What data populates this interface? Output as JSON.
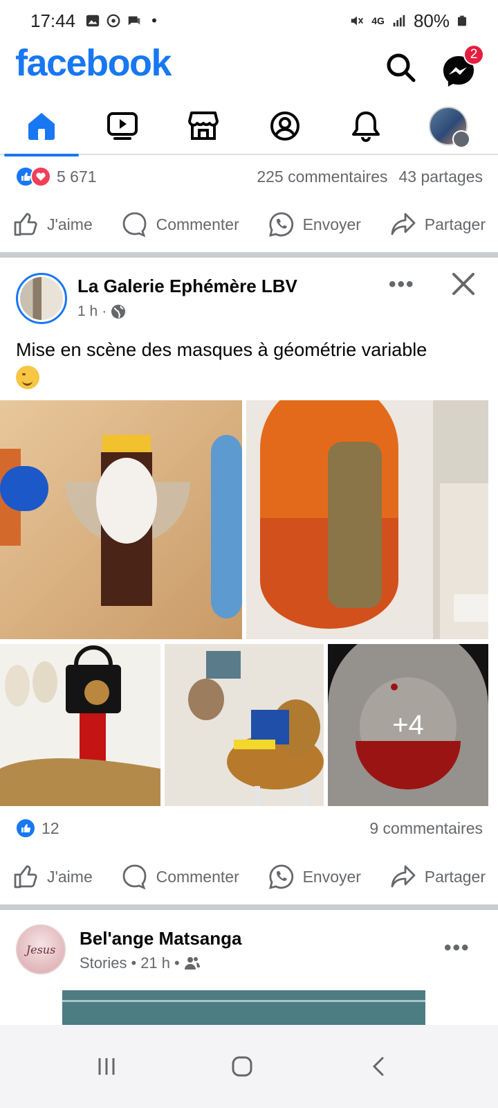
{
  "status_bar": {
    "time": "17:44",
    "battery": "80%",
    "network": "4G"
  },
  "app": {
    "logo": "facebook",
    "messenger_badge": "2"
  },
  "nav_tabs": [
    {
      "name": "home-icon",
      "active": true
    },
    {
      "name": "watch-icon",
      "active": false
    },
    {
      "name": "marketplace-icon",
      "active": false
    },
    {
      "name": "profile-icon",
      "active": false
    },
    {
      "name": "notifications-icon",
      "active": false
    },
    {
      "name": "menu-avatar",
      "active": false
    }
  ],
  "post_prev": {
    "reactions_count": "5 671",
    "comments": "225 commentaires",
    "shares": "43 partages"
  },
  "actions": {
    "like": "J'aime",
    "comment": "Commenter",
    "send": "Envoyer",
    "share": "Partager"
  },
  "post1": {
    "author": "La Galerie Ephémère LBV",
    "time": "1 h",
    "dot": "·",
    "text": "Mise en scène des masques à géométrie variable",
    "more_photos": "+4",
    "reactions_count": "12",
    "comments": "9 commentaires"
  },
  "post2": {
    "author": "Bel'ange Matsanga",
    "meta_source": "Stories",
    "time": "21 h",
    "avatar_text": "Jesus"
  },
  "colors": {
    "brand": "#1877f2",
    "badge": "#e41e3f",
    "love": "#f33e58"
  }
}
